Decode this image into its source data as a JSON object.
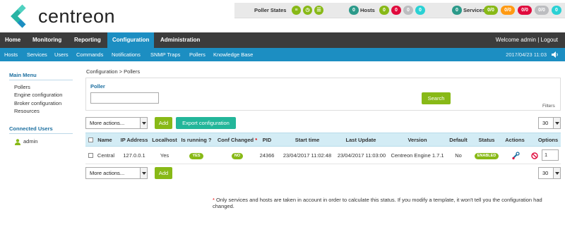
{
  "app": {
    "logo_text": "centreon"
  },
  "status": {
    "poller_label": "Poller States",
    "hosts_label": "Hosts",
    "hosts_total": "0",
    "hosts_counts": [
      "0",
      "0",
      "0",
      "0"
    ],
    "services_label": "Services",
    "services_total": "0",
    "services_counts": [
      "0/0",
      "0/0",
      "0/0",
      "0/0"
    ],
    "colors": {
      "ok": "#88b917",
      "warning": "#ff9a13",
      "critical": "#e00b3d",
      "unknown": "#bcbdc0",
      "pending": "#2ad1d4",
      "total": "#2c9a8a"
    }
  },
  "nav": {
    "main": [
      "Home",
      "Monitoring",
      "Reporting",
      "Configuration",
      "Administration"
    ],
    "active": "Configuration",
    "user_text": "Welcome admin | Logout",
    "sub": [
      "Hosts",
      "Services",
      "Users",
      "Commands",
      "Notifications",
      "SNMP Traps",
      "Pollers",
      "Knowledge Base"
    ],
    "datetime": "2017/04/23 11:03"
  },
  "sidebar": {
    "menu_title": "Main Menu",
    "menu_items": [
      "Pollers",
      "Engine configuration",
      "Broker configuration",
      "Resources"
    ],
    "users_title": "Connected Users",
    "users": [
      "admin"
    ]
  },
  "breadcrumb": "Configuration > Pollers",
  "filter": {
    "label": "Poller",
    "input_value": "",
    "search_label": "Search",
    "filters_link": "Filters"
  },
  "toolbar": {
    "more_actions": "More actions...",
    "add_label": "Add",
    "export_label": "Export configuration",
    "page_size": "30"
  },
  "table": {
    "headers": [
      "Name",
      "IP Address",
      "Localhost",
      "Is running ?",
      "Conf Changed",
      "PID",
      "Start time",
      "Last Update",
      "Version",
      "Default",
      "Status",
      "Actions",
      "Options"
    ],
    "conf_changed_star": "*",
    "rows": [
      {
        "name": "Central",
        "ip": "127.0.0.1",
        "localhost": "Yes",
        "running": "YES",
        "conf_changed": "NO",
        "pid": "24366",
        "start_time": "23/04/2017 11:02:48",
        "last_update": "23/04/2017 11:03:00",
        "version": "Centreon Engine 1.7.1",
        "default": "No",
        "status": "ENABLED",
        "option_value": "1"
      }
    ]
  },
  "footnote": {
    "star": "*",
    "text": "Only services and hosts are taken in account in order to calculate this status. If you modify a template, it won't tell you the configuration had changed."
  }
}
